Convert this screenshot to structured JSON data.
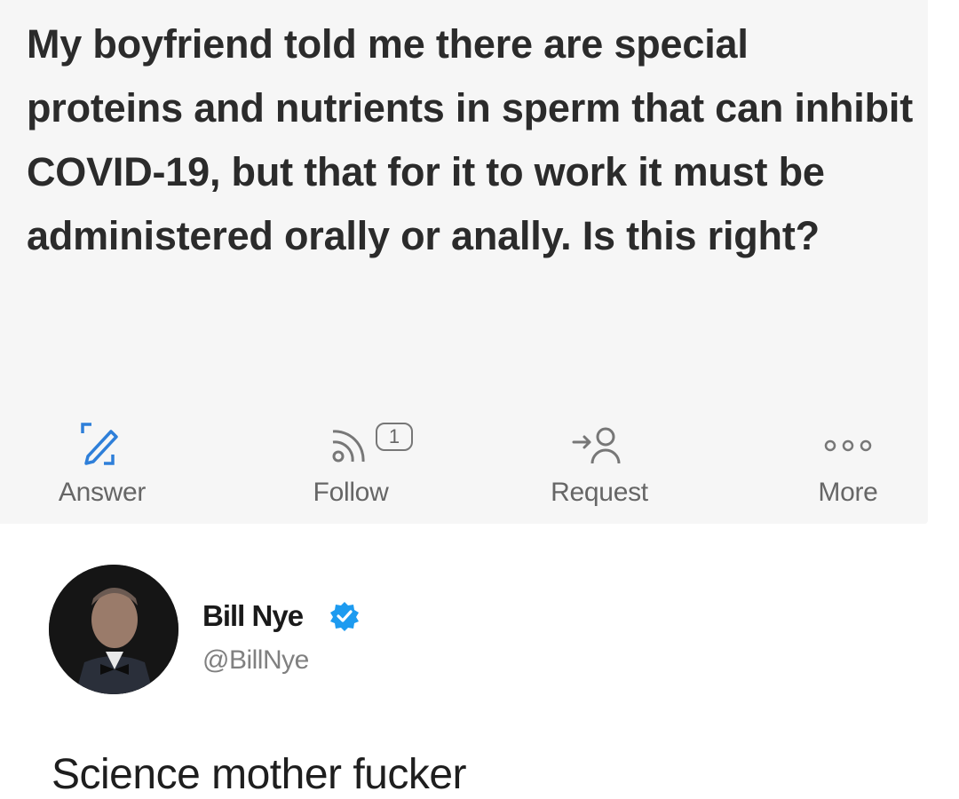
{
  "question": {
    "text": "My boyfriend told me there are special proteins and nutrients in sperm that can inhibit COVID-19, but that for it to work it must be administered orally or anally. Is this right?"
  },
  "actions": [
    {
      "label": "Answer",
      "icon": "pencil-edit-icon"
    },
    {
      "label": "Follow",
      "icon": "rss-feed-icon",
      "badge": "1"
    },
    {
      "label": "Request",
      "icon": "add-person-icon"
    },
    {
      "label": "More",
      "icon": "more-dots-icon"
    }
  ],
  "tweet": {
    "author_name": "Bill Nye",
    "handle": "@BillNye",
    "verified": true,
    "text": "Science mother fucker"
  },
  "colors": {
    "card_bg": "#f6f6f6",
    "text": "#2b2b2b",
    "muted": "#666666",
    "verified_blue": "#1d9bf0"
  }
}
